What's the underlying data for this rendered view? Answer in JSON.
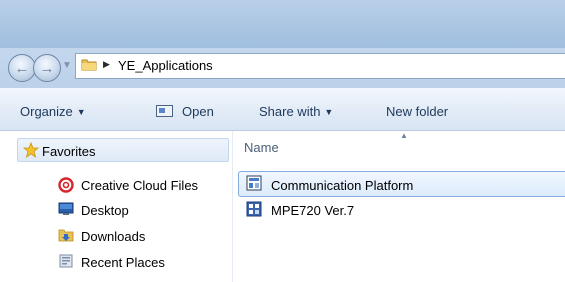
{
  "address": {
    "path_segment": "YE_Applications"
  },
  "toolbar": {
    "organize": "Organize",
    "open": "Open",
    "share_with": "Share with",
    "new_folder": "New folder"
  },
  "nav": {
    "favorites": "Favorites",
    "items": [
      {
        "label": "Creative Cloud Files",
        "icon": "creative-cloud-icon"
      },
      {
        "label": "Desktop",
        "icon": "desktop-icon"
      },
      {
        "label": "Downloads",
        "icon": "downloads-folder-icon"
      },
      {
        "label": "Recent Places",
        "icon": "recent-places-icon"
      }
    ]
  },
  "content": {
    "column_name": "Name",
    "files": [
      {
        "name": "Communication Platform",
        "icon": "app-shortcut-icon",
        "selected": true
      },
      {
        "name": "MPE720 Ver.7",
        "icon": "app-shortcut-icon",
        "selected": false
      }
    ]
  },
  "colors": {
    "accent": "#84acdd",
    "header_text": "#1e395b"
  }
}
